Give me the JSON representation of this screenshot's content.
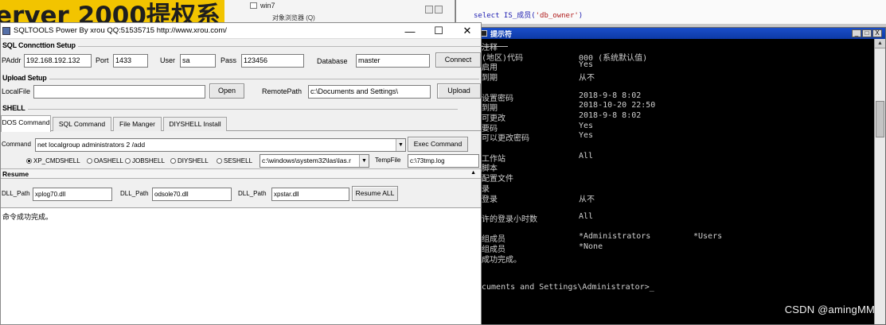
{
  "background": {
    "banner_text": "erver 2000提权系",
    "tree_item": "win7",
    "object_browser_label": "对象浏览器 (Q)",
    "query_code_prefix": "select IS_",
    "query_code_func": "成员(",
    "query_code_str": "'db_owner'",
    "query_code_suffix": ")"
  },
  "sqltools": {
    "title": "SQLTOOLS  Power By xrou   QQ:51535715   http://www.xrou.com/",
    "window_controls": {
      "minimize": "—",
      "maximize": "☐",
      "close": "✕"
    },
    "connection": {
      "section": "SQL Conncttion Setup",
      "ip_label": "PAddr",
      "ip_value": "192.168.192.132",
      "port_label": "Port",
      "port_value": "1433",
      "user_label": "User",
      "user_value": "sa",
      "pass_label": "Pass",
      "pass_value": "123456",
      "db_label": "Database",
      "db_value": "master",
      "connect_button": "Connect"
    },
    "upload": {
      "section": "Upload Setup",
      "local_label": "LocalFile",
      "local_value": "",
      "open_button": "Open",
      "remote_label": "RemotePath",
      "remote_value": "c:\\Documents and Settings\\",
      "upload_button": "Upload"
    },
    "shell": {
      "section": "SHELL",
      "tabs": [
        "DOS Command",
        "SQL Command",
        "File Manger",
        "DIYSHELL Install"
      ],
      "command_label": "Command",
      "command_value": "net localgroup administrators 2 /add",
      "exec_button": "Exec Command",
      "radios": [
        "XP_CMDSHELL",
        "OASHELL",
        "JOBSHELL",
        "DIYSHELL",
        "SESHELL"
      ],
      "path_value": "c:\\windows\\system32\\las\\las.r",
      "temp_label": "TempFile",
      "temp_value": "c:\\73tmp.log"
    },
    "resume": {
      "section": "Resume",
      "collapse_glyph": "▲",
      "dll1_label": "DLL_Path",
      "dll1_value": "xplog70.dll",
      "dll2_label": "DLL_Path",
      "dll2_value": "odsole70.dll",
      "dll3_label": "DLL_Path",
      "dll3_value": "xpstar.dll",
      "resume_button": "Resume ALL"
    },
    "output_text": "命令成功完成。"
  },
  "cmd": {
    "title": "提示符",
    "controls": {
      "minimize": "_",
      "maximize": "□",
      "close": "X"
    },
    "lines": [
      {
        "k": "注释",
        "v": ""
      },
      {
        "k": "(地区)代码",
        "v": "000 (系统默认值)"
      },
      {
        "k": "启用",
        "v": "Yes"
      },
      {
        "k": "到期",
        "v": "从不"
      },
      {
        "k": "",
        "v": ""
      },
      {
        "k": "设置密码",
        "v": "2018-9-8 8:02"
      },
      {
        "k": "到期",
        "v": "2018-10-20 22:50"
      },
      {
        "k": "可更改",
        "v": "2018-9-8 8:02"
      },
      {
        "k": "要码",
        "v": "Yes"
      },
      {
        "k": "可以更改密码",
        "v": "Yes"
      },
      {
        "k": "",
        "v": ""
      },
      {
        "k": "工作站",
        "v": "All"
      },
      {
        "k": "脚本",
        "v": ""
      },
      {
        "k": "配置文件",
        "v": ""
      },
      {
        "k": "录",
        "v": ""
      },
      {
        "k": "登录",
        "v": "从不"
      },
      {
        "k": "",
        "v": ""
      },
      {
        "k": "许的登录小时数",
        "v": "All"
      },
      {
        "k": "",
        "v": ""
      },
      {
        "k": "组成员",
        "v": "*Administrators",
        "v2": "*Users"
      },
      {
        "k": "组成员",
        "v": "*None"
      },
      {
        "k": "成功完成。",
        "v": ""
      },
      {
        "k": "",
        "v": ""
      },
      {
        "k": "",
        "v": ""
      },
      {
        "k": "cuments and Settings\\Administrator>_",
        "v": ""
      }
    ]
  },
  "watermark": "CSDN @amingMM"
}
